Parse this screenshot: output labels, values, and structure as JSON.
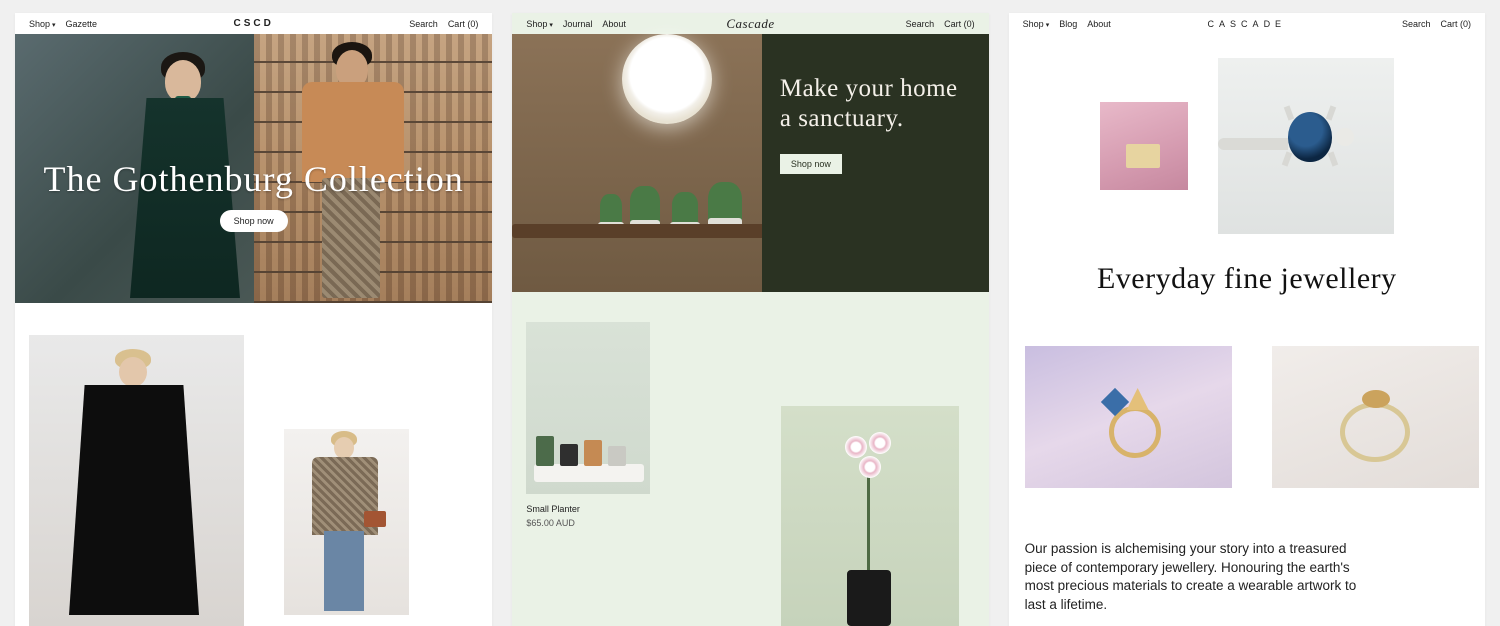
{
  "panel1": {
    "nav": {
      "shop": "Shop",
      "link2": "Gazette",
      "logo": "CSCD",
      "search": "Search",
      "cart": "Cart (0)"
    },
    "hero": {
      "title": "The Gothenburg Collection",
      "cta": "Shop now"
    }
  },
  "panel2": {
    "nav": {
      "shop": "Shop",
      "link2": "Journal",
      "link3": "About",
      "logo": "Cascade",
      "search": "Search",
      "cart": "Cart (0)"
    },
    "hero": {
      "title": "Make your home a sanctuary.",
      "cta": "Shop now"
    },
    "product": {
      "name": "Small Planter",
      "price": "$65.00 AUD"
    }
  },
  "panel3": {
    "nav": {
      "shop": "Shop",
      "link2": "Blog",
      "link3": "About",
      "logo": "CASCADE",
      "search": "Search",
      "cart": "Cart (0)"
    },
    "title": "Everyday fine jewellery",
    "body": "Our passion is alchemising your story into a treasured piece of contemporary jewellery.  Honouring the earth's most precious materials to create a wearable artwork to last a lifetime."
  }
}
